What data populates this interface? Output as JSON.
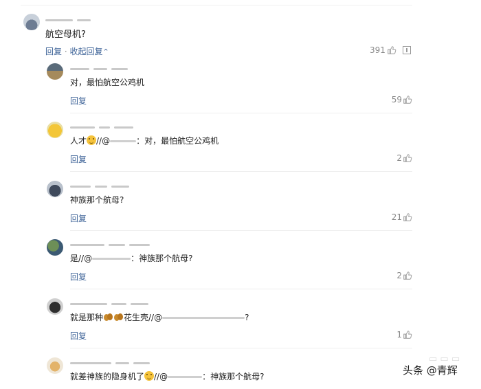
{
  "top_comment": {
    "text": "航空母机?",
    "reply_label": "回复",
    "separator": "·",
    "collapse_label": "收起回复",
    "collapse_arrow": "⌃",
    "likes": "391"
  },
  "replies": [
    {
      "text": "对，最怕航空公鸡机",
      "reply_label": "回复",
      "likes": "59"
    },
    {
      "text_prefix": "人才",
      "text_mid": "//@",
      "text_suffix": "：对，最怕航空公鸡机",
      "reply_label": "回复",
      "likes": "2"
    },
    {
      "text": "神族那个航母?",
      "reply_label": "回复",
      "likes": "21"
    },
    {
      "text_prefix": "是//@",
      "text_suffix": "：神族那个航母?",
      "reply_label": "回复",
      "likes": "2"
    },
    {
      "text_prefix": "就是那种",
      "text_mid": "花生壳//@",
      "text_suffix": "?",
      "reply_label": "回复",
      "likes": "1"
    },
    {
      "text_prefix": "就差神族的隐身机了",
      "text_mid": "//@",
      "text_suffix": "：神族那个航母?"
    }
  ],
  "watermark": "头条 @青辉",
  "colors": {
    "link": "#406599",
    "muted": "#888888",
    "divider": "#eeeeee"
  },
  "icons": [
    "thumb-up-icon",
    "report-icon",
    "smile-emoji-icon",
    "peanut-emoji-icon"
  ]
}
